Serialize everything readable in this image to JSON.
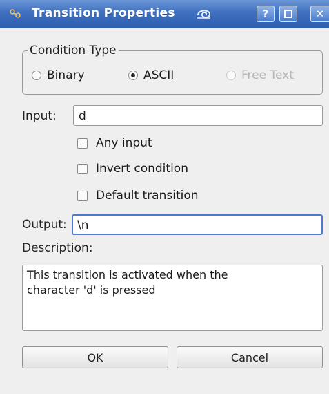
{
  "window": {
    "title": "Transition Properties",
    "help_label": "?",
    "close_label": "✕"
  },
  "condition_type": {
    "title": "Condition Type",
    "options": [
      {
        "label": "Binary",
        "selected": false,
        "enabled": true
      },
      {
        "label": "ASCII",
        "selected": true,
        "enabled": true
      },
      {
        "label": "Free Text",
        "selected": false,
        "enabled": false
      }
    ]
  },
  "input": {
    "label": "Input:",
    "value": "d"
  },
  "checkboxes": [
    {
      "label": "Any input",
      "checked": false
    },
    {
      "label": "Invert condition",
      "checked": false
    },
    {
      "label": "Default transition",
      "checked": false
    }
  ],
  "output": {
    "label": "Output:",
    "value": "\\n"
  },
  "description": {
    "label": "Description:",
    "value": "This transition is activated when the\ncharacter 'd' is pressed"
  },
  "buttons": {
    "ok": "OK",
    "cancel": "Cancel"
  },
  "colors": {
    "titlebar": "#3f6fbf",
    "focus": "#4a7bd0",
    "dialog_bg": "#efefef"
  }
}
